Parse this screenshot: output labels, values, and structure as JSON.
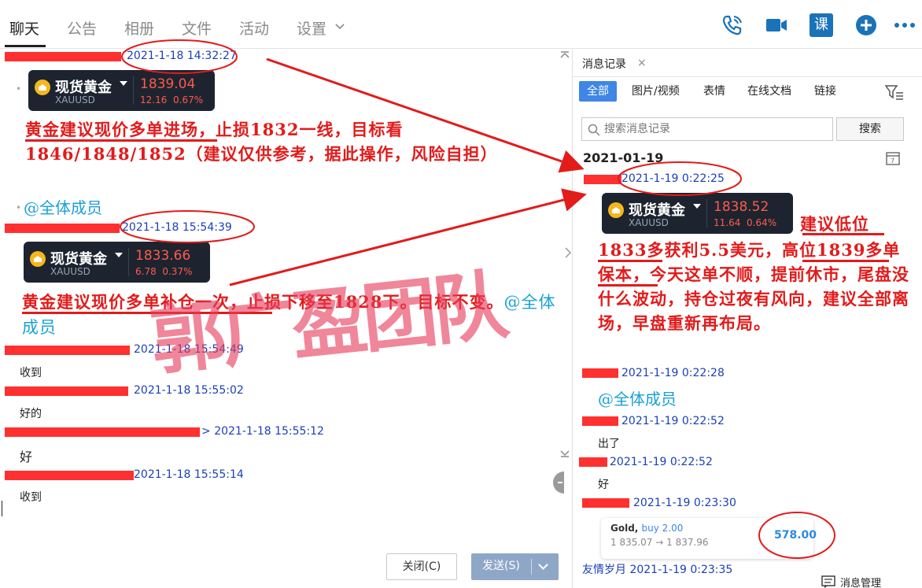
{
  "tabs": [
    {
      "label": "聊天"
    },
    {
      "label": "公告"
    },
    {
      "label": "相册"
    },
    {
      "label": "文件"
    },
    {
      "label": "活动"
    },
    {
      "label": "设置"
    }
  ],
  "top_icons": [
    "phone-icon",
    "video-icon",
    "lesson-icon",
    "plus-icon",
    "more-icon"
  ],
  "lesson_label": "课",
  "left": {
    "msg1": {
      "timestamp": "2021-1-18 14:32:27",
      "quote": {
        "name": "现货黄金",
        "symbol": "XAUUSD",
        "price": "1839.04",
        "change": "12.16",
        "pct": "0.67%"
      },
      "text": "黄金建议现价多单进场，止损1832一线，目标看1846/1848/1852（建议仅供参考，据此操作，风险自担）",
      "mention": "@全体成员"
    },
    "msg2": {
      "timestamp": "2021-1-18 15:54:39",
      "quote": {
        "name": "现货黄金",
        "symbol": "XAUUSD",
        "price": "1833.66",
        "change": "6.78",
        "pct": "0.37%"
      },
      "text": "黄金建议现价多单补仓一次，止损下移至1828下。目标不变。",
      "mention": "@全体成员"
    },
    "msg3": {
      "timestamp": "2021-1-18 15:54:49",
      "text": "收到"
    },
    "msg4": {
      "timestamp": "2021-1-18 15:55:02",
      "text": "好的"
    },
    "msg5": {
      "timestamp": "2021-1-18 15:55:12",
      "prefix": ">",
      "text": "好"
    },
    "msg6": {
      "timestamp": "2021-1-18 15:55:14",
      "text": "收到"
    },
    "watermark": "郭广盈团队",
    "buttons": {
      "close": "关闭(C)",
      "send": "发送(S)"
    }
  },
  "right": {
    "tab": "消息记录",
    "tab_close": "×",
    "filters": [
      "全部",
      "图片/视频",
      "表情",
      "在线文档",
      "链接"
    ],
    "search": {
      "placeholder": "搜索消息记录",
      "button": "搜索"
    },
    "date": "2021-01-19",
    "msg1": {
      "timestamp": "2021-1-19 0:22:25",
      "quote": {
        "name": "现货黄金",
        "symbol": "XAUUSD",
        "price": "1838.52",
        "change": "11.64",
        "pct": "0.64%"
      },
      "text_line1": "建议低位",
      "text_rest": "1833多获利5.5美元，高位1839多单保本，今天这单不顺，提前休市，尾盘没什么波动，持仓过夜有风向，建议全部离场，早盘重新再布局。"
    },
    "msg2": {
      "timestamp": "2021-1-19 0:22:28",
      "mention": "@全体成员"
    },
    "msg3": {
      "timestamp": "2021-1-19 0:22:52",
      "text": "出了"
    },
    "msg4": {
      "timestamp": "2021-1-19 0:22:52",
      "text": "好"
    },
    "msg5": {
      "timestamp": "2021-1-19 0:23:30",
      "trade": {
        "instrument": "Gold,",
        "side": "buy 2.00",
        "prices": "1 835.07 → 1 837.96",
        "profit": "578.00"
      }
    },
    "msg6_partial": "友情岁月 2021-1-19 0:23:35",
    "footer": "消息管理"
  },
  "colors": {
    "annotation_red": "#e21b1b",
    "timestamp_blue": "#1a3fb8",
    "accent_blue": "#3f86e5",
    "mention_blue": "#1aa1d6"
  }
}
